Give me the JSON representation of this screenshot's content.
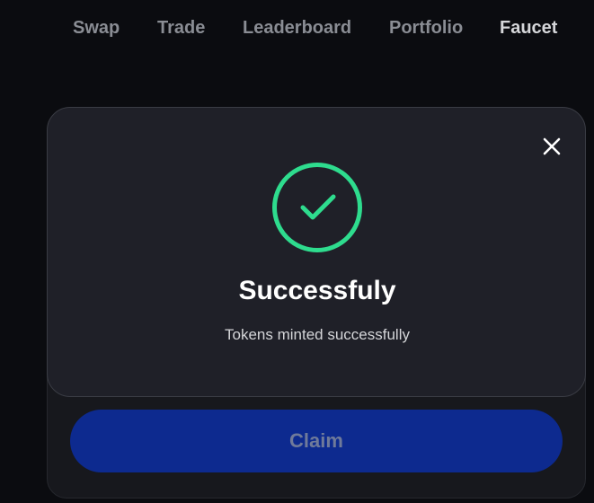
{
  "nav": {
    "items": [
      {
        "label": "Swap"
      },
      {
        "label": "Trade"
      },
      {
        "label": "Leaderboard"
      },
      {
        "label": "Portfolio"
      },
      {
        "label": "Faucet"
      }
    ],
    "active": "Faucet"
  },
  "faucet": {
    "claim_label": "Claim"
  },
  "modal": {
    "icon": "check-circle-icon",
    "close_icon": "close-icon",
    "title": "Successfuly",
    "message": "Tokens minted successfully"
  },
  "colors": {
    "background": "#0b0c10",
    "modal_background": "#1f2028",
    "success_green": "#2edc8e",
    "claim_button": "#0d2a8f",
    "nav_inactive": "#8a8d94",
    "nav_active": "#d6d7da"
  }
}
